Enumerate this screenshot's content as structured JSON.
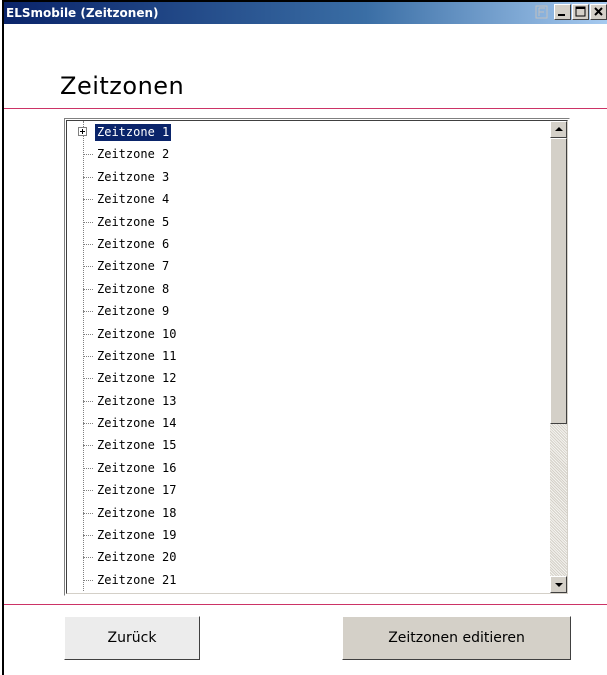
{
  "window": {
    "title": "ELSmobile (Zeitzonen)",
    "buttons": [
      "minimize-icon",
      "maximize-icon",
      "close-icon"
    ],
    "titlebar_gradient": [
      "#0a246a",
      "#a6caf0"
    ]
  },
  "page": {
    "heading": "Zeitzonen",
    "accent_line_color": "#cc3366"
  },
  "tree": {
    "items": [
      {
        "label": "Zeitzone 1",
        "selected": true,
        "expandable": true
      },
      {
        "label": "Zeitzone 2"
      },
      {
        "label": "Zeitzone 3"
      },
      {
        "label": "Zeitzone 4"
      },
      {
        "label": "Zeitzone 5"
      },
      {
        "label": "Zeitzone 6"
      },
      {
        "label": "Zeitzone 7"
      },
      {
        "label": "Zeitzone 8"
      },
      {
        "label": "Zeitzone 9"
      },
      {
        "label": "Zeitzone 10"
      },
      {
        "label": "Zeitzone 11"
      },
      {
        "label": "Zeitzone 12"
      },
      {
        "label": "Zeitzone 13"
      },
      {
        "label": "Zeitzone 14"
      },
      {
        "label": "Zeitzone 15"
      },
      {
        "label": "Zeitzone 16"
      },
      {
        "label": "Zeitzone 17"
      },
      {
        "label": "Zeitzone 18"
      },
      {
        "label": "Zeitzone 19"
      },
      {
        "label": "Zeitzone 20"
      },
      {
        "label": "Zeitzone 21"
      }
    ],
    "selection_color": "#0a246a"
  },
  "actions": {
    "back_label": "Zurück",
    "edit_label": "Zeitzonen editieren"
  }
}
